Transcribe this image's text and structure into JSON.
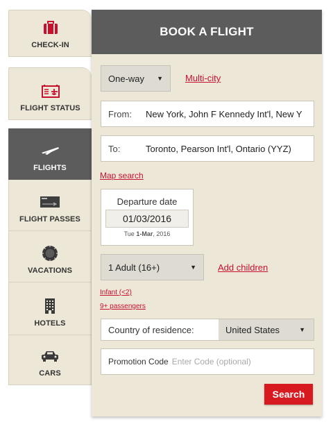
{
  "colors": {
    "accent": "#c8102e",
    "header": "#5c5c5c",
    "panel_bg": "#ede7d8"
  },
  "tabs": [
    {
      "label": "CHECK-IN",
      "icon": "suitcase-icon"
    },
    {
      "label": "FLIGHT STATUS",
      "icon": "departures-board-icon"
    },
    {
      "label": "FLIGHTS",
      "icon": "airplane-icon",
      "active": true
    },
    {
      "label": "FLIGHT PASSES",
      "icon": "ticket-icon"
    },
    {
      "label": "VACATIONS",
      "icon": "sun-icon"
    },
    {
      "label": "HOTELS",
      "icon": "building-icon"
    },
    {
      "label": "CARS",
      "icon": "car-icon"
    }
  ],
  "panel": {
    "title": "BOOK A FLIGHT",
    "trip_type": "One-way",
    "multi_city_link": "Multi-city",
    "from_label": "From:",
    "from_value": "New York, John F Kennedy Int'l, New Y",
    "to_label": "To:",
    "to_value": "Toronto, Pearson Int'l, Ontario (YYZ)",
    "map_search_link": "Map search",
    "departure": {
      "title": "Departure date",
      "value": "01/03/2016",
      "weekday": "Tue",
      "day_month": "1-Mar",
      "year": ", 2016"
    },
    "passengers": "1 Adult (16+)",
    "add_children_link": "Add children",
    "infant_link": "Infant (<2)",
    "nine_plus_link": "9+ passengers",
    "country_label": "Country of residence:",
    "country_value": "United States",
    "promo_label": "Promotion Code",
    "promo_placeholder": "Enter Code (optional)",
    "search_label": "Search"
  }
}
